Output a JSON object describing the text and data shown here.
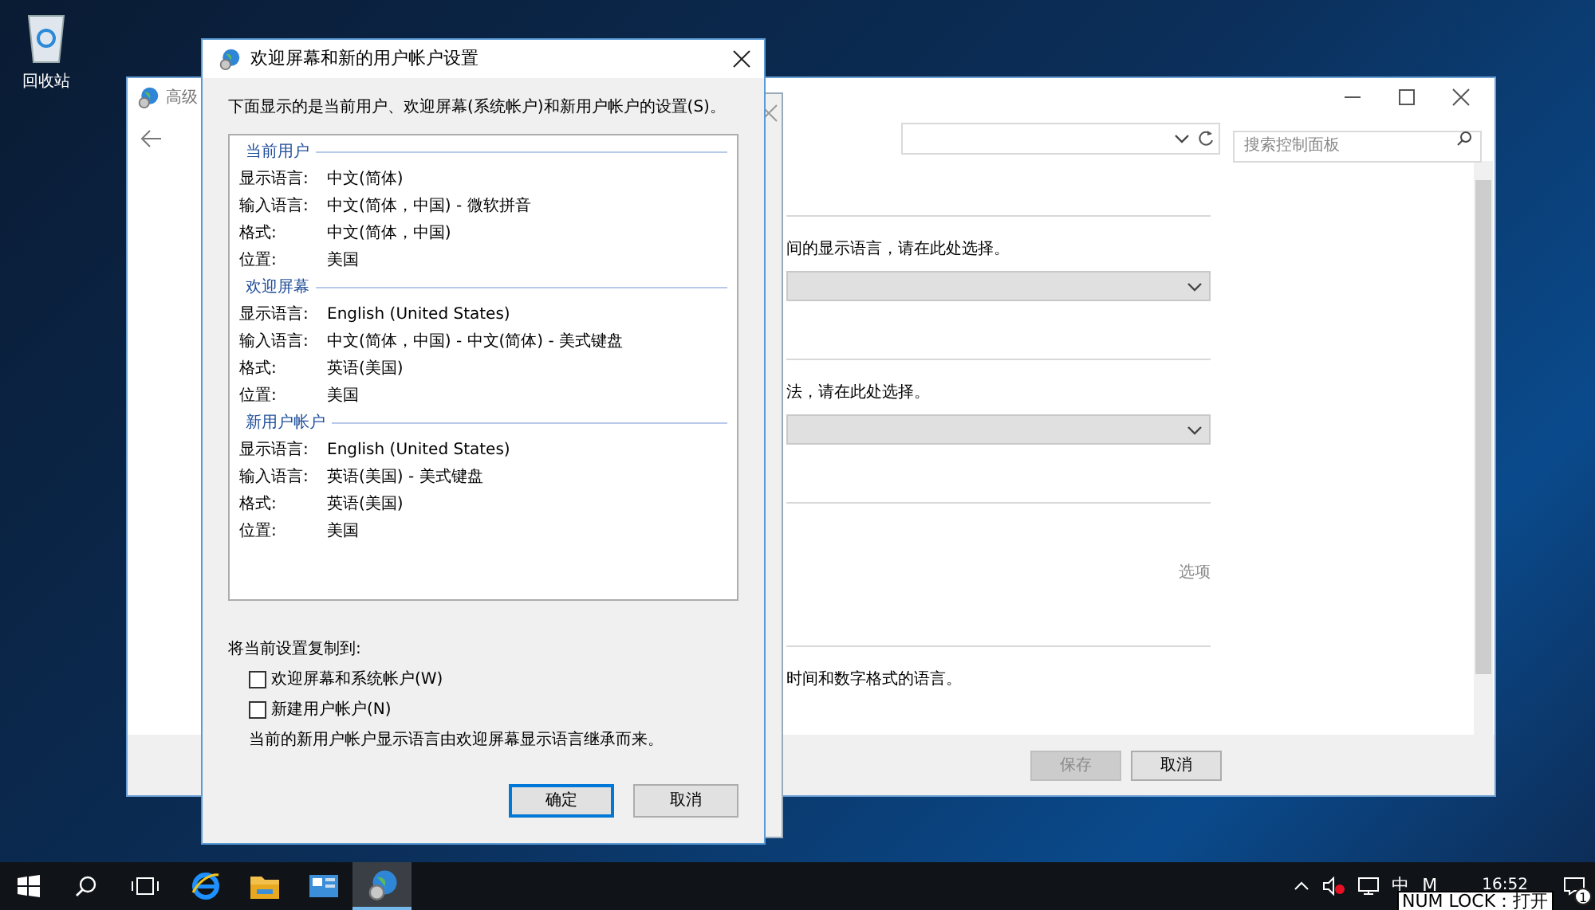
{
  "desktop_icons": [
    {
      "label": "回收站"
    }
  ],
  "back_window": {
    "title": "高级",
    "search_placeholder": "搜索控制面板",
    "content": [
      {
        "kind": "divider"
      },
      {
        "kind": "text",
        "text": "间的显示语言，请在此处选择。"
      },
      {
        "kind": "dropdown"
      },
      {
        "kind": "divider"
      },
      {
        "kind": "text",
        "text": "法，请在此处选择。"
      },
      {
        "kind": "dropdown"
      },
      {
        "kind": "divider"
      },
      {
        "kind": "link",
        "text": "选项"
      },
      {
        "kind": "divider"
      },
      {
        "kind": "text",
        "text": "时间和数字格式的语言。"
      }
    ],
    "buttons": [
      {
        "label": "保存",
        "disabled": true
      },
      {
        "label": "取消",
        "disabled": false
      }
    ]
  },
  "dialog": {
    "title": "欢迎屏幕和新的用户帐户设置",
    "description": "下面显示的是当前用户、欢迎屏幕(系统帐户)和新用户帐户的设置(S)。",
    "sections": [
      {
        "heading": "当前用户",
        "rows": [
          {
            "label": "显示语言:",
            "value": "中文(简体)"
          },
          {
            "label": "输入语言:",
            "value": "中文(简体，中国) - 微软拼音"
          },
          {
            "label": "格式:",
            "value": "中文(简体，中国)"
          },
          {
            "label": "位置:",
            "value": "美国"
          }
        ]
      },
      {
        "heading": "欢迎屏幕",
        "rows": [
          {
            "label": "显示语言:",
            "value": "English (United States)"
          },
          {
            "label": "输入语言:",
            "value": "中文(简体，中国) - 中文(简体) - 美式键盘"
          },
          {
            "label": "格式:",
            "value": "英语(美国)"
          },
          {
            "label": "位置:",
            "value": "美国"
          }
        ]
      },
      {
        "heading": "新用户帐户",
        "rows": [
          {
            "label": "显示语言:",
            "value": "English (United States)"
          },
          {
            "label": "输入语言:",
            "value": "英语(美国) - 美式键盘"
          },
          {
            "label": "格式:",
            "value": "英语(美国)"
          },
          {
            "label": "位置:",
            "value": "美国"
          }
        ]
      }
    ],
    "copy_label": "将当前设置复制到:",
    "checkboxes": [
      {
        "label": "欢迎屏幕和系统帐户(W)",
        "checked": false
      },
      {
        "label": "新建用户帐户(N)",
        "checked": false
      }
    ],
    "note": "当前的新用户帐户显示语言由欢迎屏幕显示语言继承而来。",
    "buttons": [
      {
        "label": "确定",
        "default": true
      },
      {
        "label": "取消",
        "default": false
      }
    ]
  },
  "taskbar": {
    "apps": [
      {
        "kind": "ie",
        "selected": false
      },
      {
        "kind": "folder",
        "selected": false
      },
      {
        "kind": "panel",
        "selected": false
      },
      {
        "kind": "globe",
        "selected": true
      }
    ],
    "ime": "中",
    "ime_mode": "M",
    "time": "16:52",
    "notification_count": "1",
    "tooltip": "NUM LOCK：打开"
  }
}
